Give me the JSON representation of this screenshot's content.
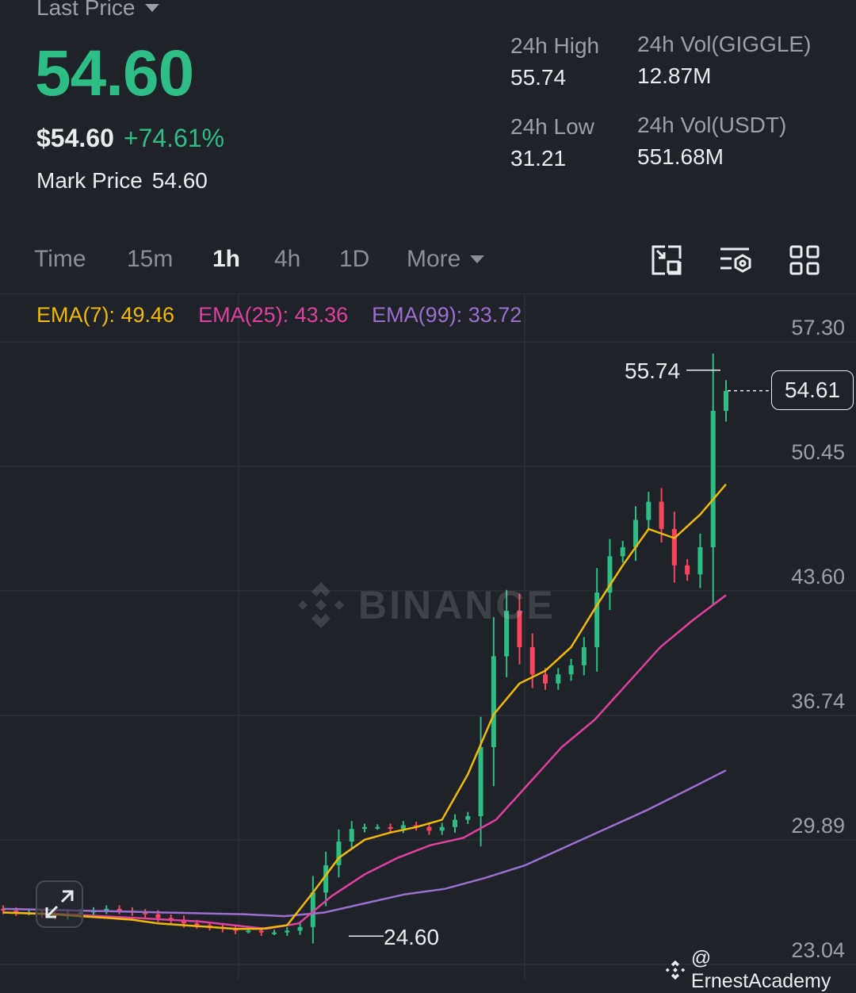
{
  "header": {
    "last_price_label": "Last Price",
    "last_price": "54.60",
    "usd_price": "$54.60",
    "change_pct": "+74.61%",
    "mark_label": "Mark Price",
    "mark_value": "54.60"
  },
  "stats": {
    "high_label": "24h High",
    "high_value": "55.74",
    "low_label": "24h Low",
    "low_value": "31.21",
    "vol_base_label": "24h Vol(GIGGLE)",
    "vol_base_value": "12.87M",
    "vol_quote_label": "24h Vol(USDT)",
    "vol_quote_value": "551.68M"
  },
  "tabs": [
    {
      "label": "Time"
    },
    {
      "label": "15m"
    },
    {
      "label": "1h",
      "active": true
    },
    {
      "label": "4h"
    },
    {
      "label": "1D"
    },
    {
      "label": "More"
    }
  ],
  "tools": [
    "chart-settings-icon",
    "indicator-icon",
    "layout-grid-icon"
  ],
  "ema": [
    {
      "label": "EMA(7): 49.46",
      "color": "#f0b90b"
    },
    {
      "label": "EMA(25): 43.36",
      "color": "#e040a0"
    },
    {
      "label": "EMA(99): 33.72",
      "color": "#9b6fd0"
    }
  ],
  "colors": {
    "up": "#2ebd85",
    "down": "#f6465d",
    "ema7": "#f0b90b",
    "ema25": "#e040a0",
    "ema99": "#9b6fd0"
  },
  "chart_data": {
    "type": "candlestick",
    "ylim": [
      23.04,
      57.3
    ],
    "y_ticks": [
      "57.30",
      "50.45",
      "43.60",
      "36.74",
      "29.89",
      "23.04"
    ],
    "current_price": "54.61",
    "high_marker": "55.74",
    "low_marker": "24.60",
    "close_series_approx": [
      26.0,
      25.9,
      25.9,
      25.8,
      25.7,
      25.8,
      25.9,
      26.0,
      26.1,
      26.0,
      25.9,
      25.8,
      25.6,
      25.5,
      25.3,
      25.2,
      25.1,
      25.0,
      24.9,
      24.9,
      24.8,
      24.8,
      24.9,
      25.1,
      27.0,
      28.5,
      29.8,
      30.5,
      30.6,
      30.6,
      30.5,
      30.7,
      30.6,
      30.4,
      30.6,
      31.0,
      31.2,
      35.0,
      40.0,
      42.5,
      40.5,
      39.0,
      38.5,
      39.0,
      39.5,
      40.5,
      43.5,
      45.5,
      46.0,
      47.5,
      48.5,
      47.0,
      45.0,
      44.5,
      46.0,
      53.5,
      54.6
    ],
    "ema7_approx": [
      25.9,
      25.85,
      25.8,
      25.7,
      25.6,
      25.5,
      25.3,
      25.2,
      25.1,
      25.0,
      25.0,
      25.2,
      27.0,
      28.9,
      29.9,
      30.3,
      30.6,
      31.0,
      33.5,
      36.8,
      38.5,
      39.2,
      40.5,
      42.8,
      45.0,
      47.0,
      46.5,
      47.8,
      49.46
    ],
    "ema25_approx": [
      25.9,
      25.85,
      25.8,
      25.7,
      25.6,
      25.5,
      25.4,
      25.2,
      25.0,
      25.3,
      26.8,
      28.0,
      28.9,
      29.6,
      30.0,
      31.0,
      33.0,
      35.0,
      36.5,
      38.5,
      40.5,
      42.0,
      43.36
    ],
    "ema99_approx": [
      26.1,
      26.05,
      26.0,
      25.95,
      25.9,
      25.85,
      25.8,
      25.7,
      25.9,
      26.4,
      26.9,
      27.2,
      27.8,
      28.5,
      29.5,
      30.5,
      31.5,
      32.6,
      33.72
    ]
  },
  "watermark": "BINANCE",
  "credit": "@ ErnestAcademy"
}
